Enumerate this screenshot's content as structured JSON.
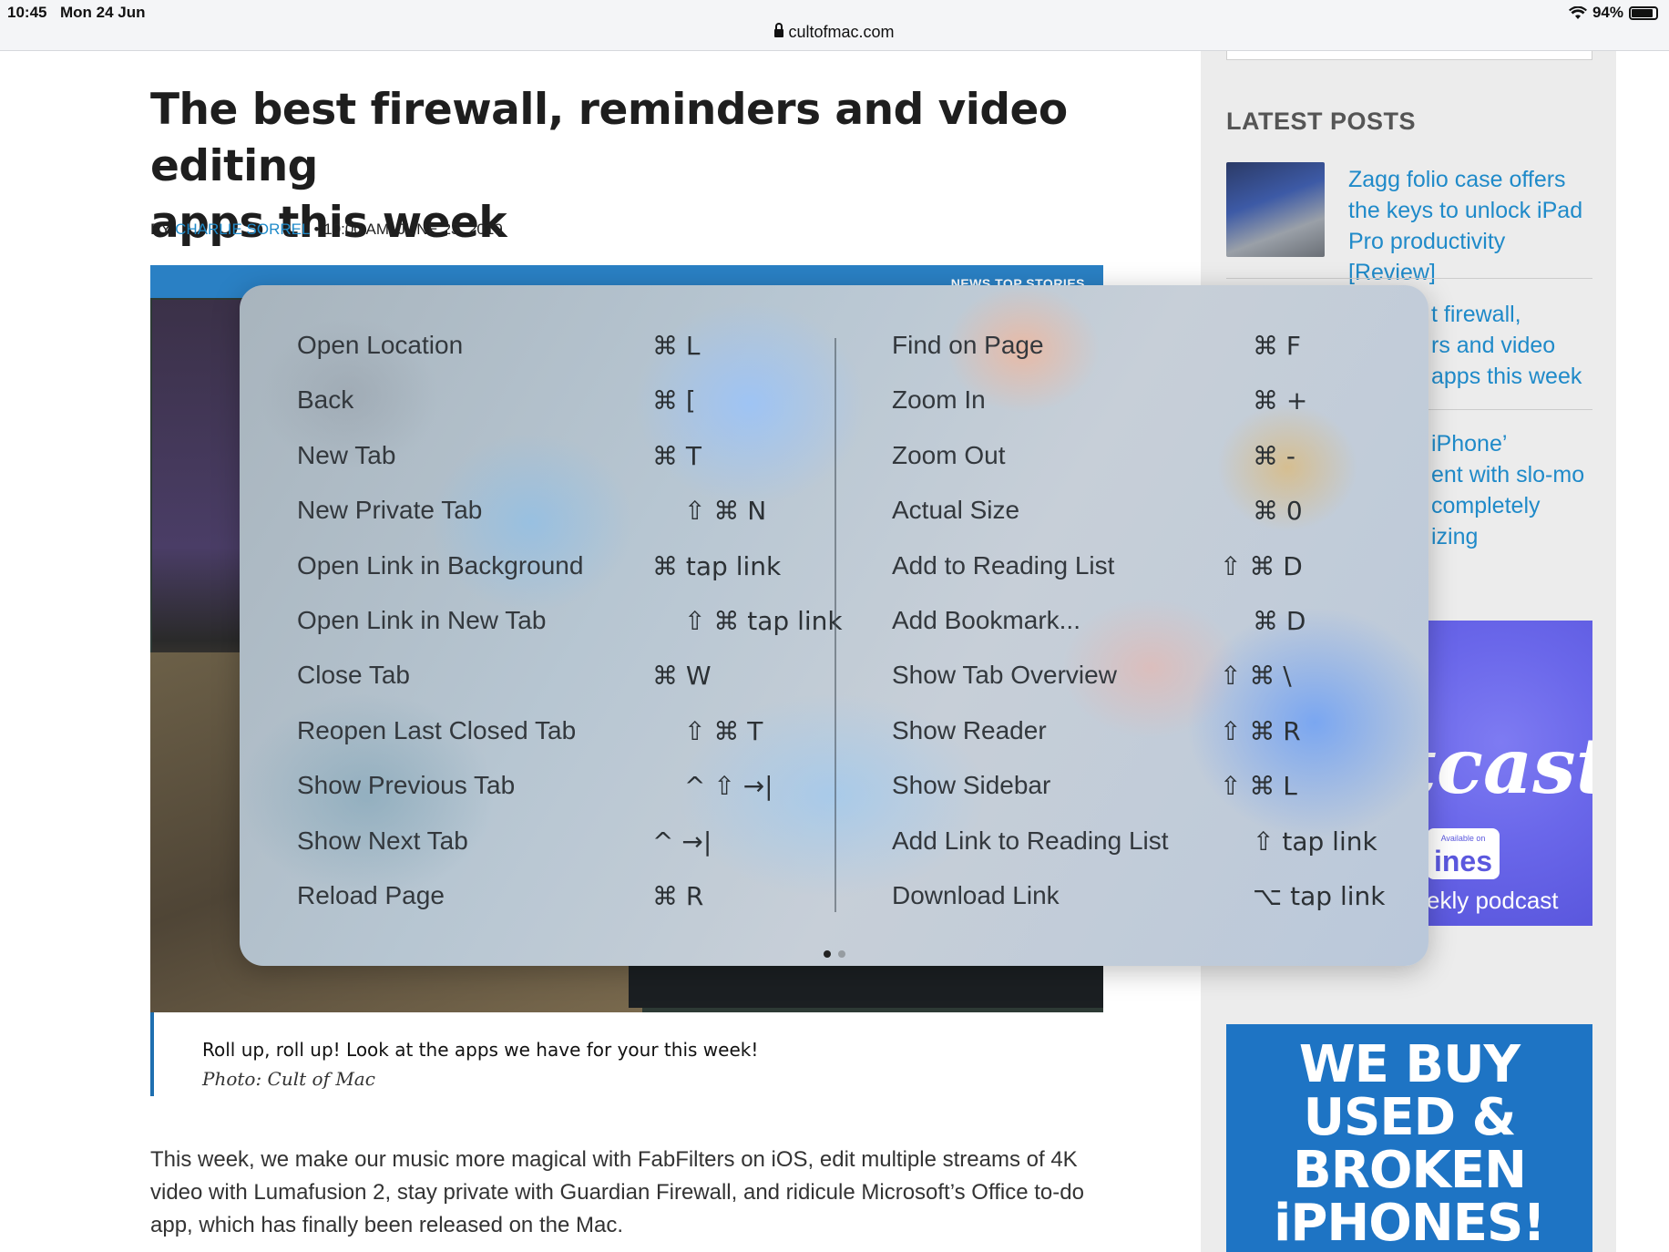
{
  "status": {
    "time": "10:45",
    "date": "Mon 24 Jun",
    "battery": "94%"
  },
  "url": "cultofmac.com",
  "article": {
    "title_line1": "The best firewall, reminders and video editing",
    "title_line2": "apps this week",
    "by": "BY",
    "author": "CHARLIE SORREL",
    "timestamp": "• 10:00 AM, JUNE 23, 2019",
    "hero_tags": "NEWS   TOP STORIES",
    "caption": "Roll up, roll up! Look at the apps we have for your this week!",
    "credit": "Photo: Cult of Mac",
    "body_line1": "This week, we make our music more magical with FabFilters on iOS, edit multiple streams of 4K",
    "body_line2": "video with Lumafusion 2, stay private with Guardian Firewall, and ridicule Microsoft’s Office to-do",
    "body_line3": "app, which has finally been released on the Mac."
  },
  "sidebar": {
    "heading": "LATEST POSTS",
    "posts": [
      {
        "line1": "Zagg folio case offers",
        "line2": "the keys to unlock iPad",
        "line3": "Pro productivity [Review]"
      },
      {
        "line1": "t firewall,",
        "line2": "rs and video",
        "line3": "apps this week"
      },
      {
        "line1": "iPhone’",
        "line2": "ent with slo-mo",
        "line3": "completely",
        "line4": "izing"
      }
    ],
    "ad1": {
      "logo": "ltcast",
      "badge_top": "Available on",
      "badge": "ines",
      "tag": "ekly podcast"
    },
    "ad2": {
      "line1": "WE BUY",
      "line2": "USED &",
      "line3": "BROKEN",
      "line4": "iPHONES!"
    }
  },
  "shortcuts": {
    "left": [
      {
        "label": "Open Location",
        "keys": "⌘ L"
      },
      {
        "label": "Back",
        "keys": "⌘ ["
      },
      {
        "label": "New Tab",
        "keys": "⌘ T"
      },
      {
        "label": "New Private Tab",
        "keys": "⇧ ⌘ N"
      },
      {
        "label": "Open Link in Background",
        "keys": "⌘ tap link"
      },
      {
        "label": "Open Link in New Tab",
        "keys": "⇧ ⌘ tap link"
      },
      {
        "label": "Close Tab",
        "keys": "⌘ W"
      },
      {
        "label": "Reopen Last Closed Tab",
        "keys": "⇧ ⌘ T"
      },
      {
        "label": "Show Previous Tab",
        "keys": "^ ⇧ →|"
      },
      {
        "label": "Show Next Tab",
        "keys": "^ →|"
      },
      {
        "label": "Reload Page",
        "keys": "⌘ R"
      }
    ],
    "right": [
      {
        "label": "Find on Page",
        "keys": "⌘ F"
      },
      {
        "label": "Zoom In",
        "keys": "⌘ +"
      },
      {
        "label": "Zoom Out",
        "keys": "⌘ -"
      },
      {
        "label": "Actual Size",
        "keys": "⌘ 0"
      },
      {
        "label": "Add to Reading List",
        "keys": "⇧ ⌘ D"
      },
      {
        "label": "Add Bookmark...",
        "keys": "⌘ D"
      },
      {
        "label": "Show Tab Overview",
        "keys": "⇧ ⌘ \\"
      },
      {
        "label": "Show Reader",
        "keys": "⇧ ⌘ R"
      },
      {
        "label": "Show Sidebar",
        "keys": "⇧ ⌘ L"
      },
      {
        "label": "Add Link to Reading List",
        "keys": "⇧ tap link"
      },
      {
        "label": "Download Link",
        "keys": "⌥ tap link"
      }
    ],
    "pages": {
      "current": 1,
      "total": 2
    }
  }
}
